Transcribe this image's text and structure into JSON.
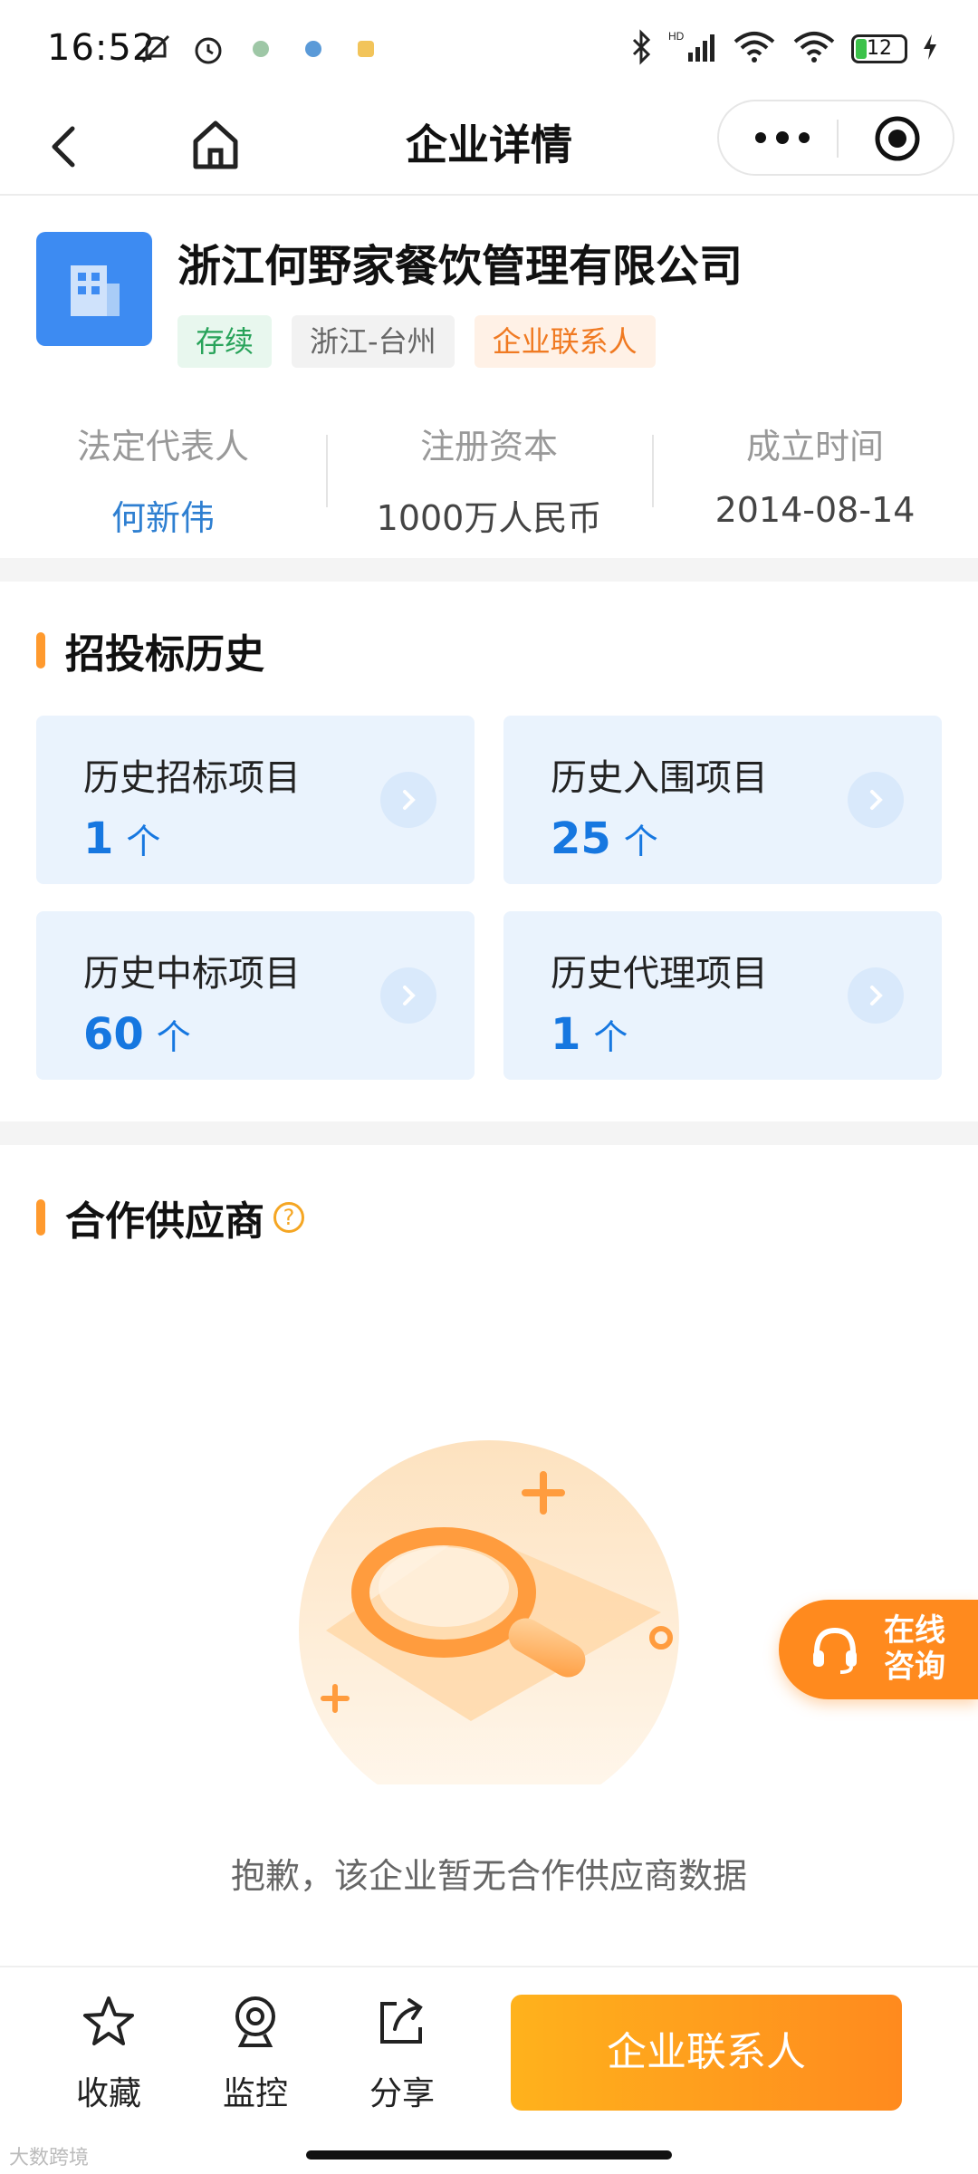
{
  "status_bar": {
    "time": "16:52",
    "battery": "12",
    "network": "HD"
  },
  "nav": {
    "title": "企业详情"
  },
  "company": {
    "name": "浙江何野家餐饮管理有限公司",
    "tags": [
      "存续",
      "浙江-台州",
      "企业联系人"
    ],
    "stats": [
      {
        "label": "法定代表人",
        "value": "何新伟"
      },
      {
        "label": "注册资本",
        "value": "1000万人民币"
      },
      {
        "label": "成立时间",
        "value": "2014-08-14"
      }
    ]
  },
  "bidding": {
    "title": "招投标历史",
    "cards": [
      {
        "label": "历史招标项目",
        "count": "1",
        "unit": "个"
      },
      {
        "label": "历史入围项目",
        "count": "25",
        "unit": "个"
      },
      {
        "label": "历史中标项目",
        "count": "60",
        "unit": "个"
      },
      {
        "label": "历史代理项目",
        "count": "1",
        "unit": "个"
      }
    ]
  },
  "suppliers": {
    "title": "合作供应商",
    "help": "?",
    "empty_text": "抱歉，该企业暂无合作供应商数据"
  },
  "float_consult": {
    "label": "在线咨询"
  },
  "bottom": {
    "items": [
      {
        "label": "收藏",
        "icon": "star-icon"
      },
      {
        "label": "监控",
        "icon": "monitor-icon"
      },
      {
        "label": "分享",
        "icon": "share-icon"
      }
    ],
    "cta": "企业联系人"
  },
  "footer_brand": "大数跨境",
  "colors": {
    "accent_orange": "#ff8a1e",
    "blue_count": "#1677e0",
    "card_bg": "#eaf3fd",
    "logo_blue": "#3d8bf2"
  }
}
